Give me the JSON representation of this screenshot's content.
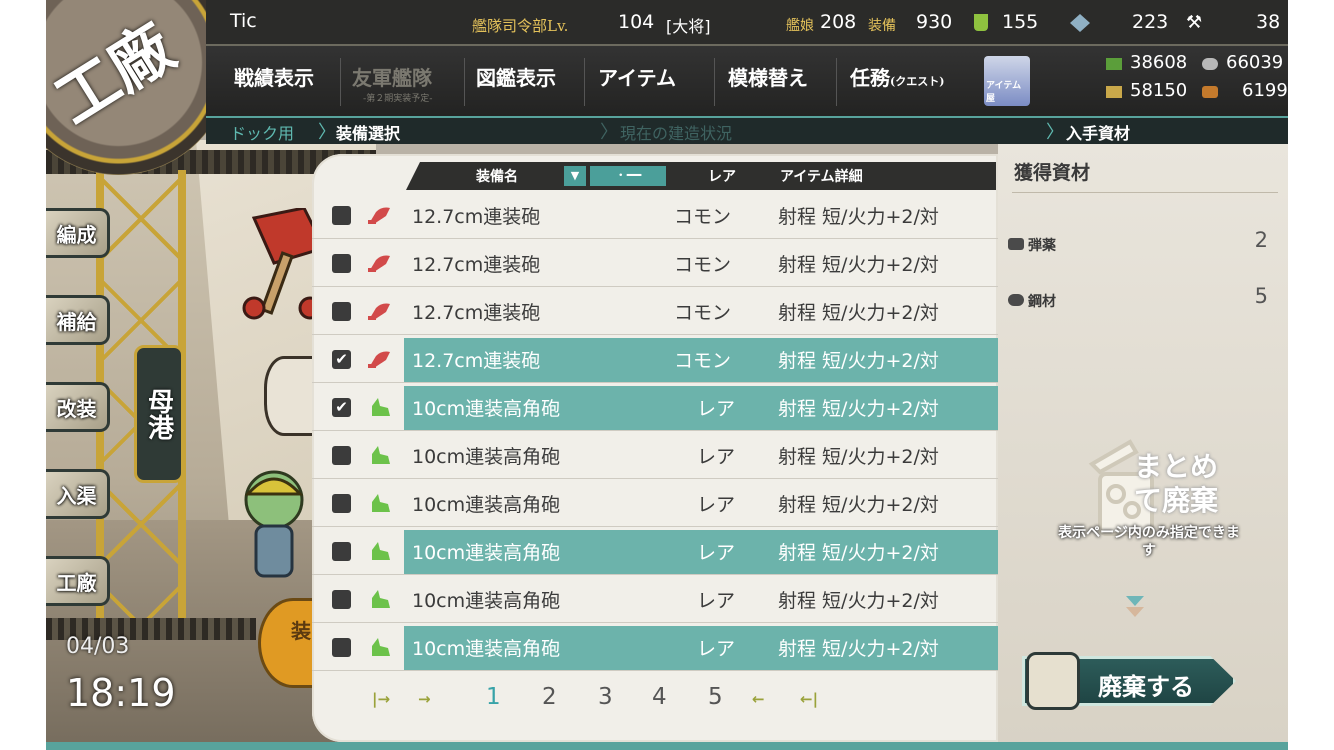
{
  "badge": {
    "title": "工廠"
  },
  "side_nav": [
    "編成",
    "補給",
    "改装",
    "入渠",
    "工廠"
  ],
  "port_label": "母港",
  "clock": {
    "date": "04/03",
    "time": "18:19"
  },
  "topbar": {
    "admiral": "Tic",
    "hq_label": "艦隊司令部Lv.",
    "hq_level": "104",
    "rank": "[大将]",
    "ships_label": "艦娘",
    "ships": "208",
    "equip_label": "装備",
    "equip": "930",
    "bucket": "155",
    "devmat": "223",
    "screws": "38"
  },
  "menu": {
    "record": "戦績表示",
    "friendly": "友軍艦隊",
    "friendly_sub": "-第２期実装予定-",
    "album": "図鑑表示",
    "items": "アイテム",
    "remodel": "模様替え",
    "quest": "任務",
    "quest_sub": "(クエスト)",
    "item_shop": "アイテム屋"
  },
  "resources": {
    "fuel": "38608",
    "steel": "66039",
    "ammo": "58150",
    "bauxite": "6199"
  },
  "breadcrumb": {
    "dock": "ドック用",
    "select": "装備選択",
    "current": "現在の建造状況",
    "gain": "入手資材"
  },
  "list": {
    "header": {
      "name": "装備名",
      "sort_arrow": "▼",
      "sort_mode": "・━━",
      "rarity": "レア",
      "detail": "アイテム詳細"
    },
    "rows": [
      {
        "checked": false,
        "name": "12.7cm連装砲",
        "rarity": "コモン",
        "detail": "射程 短/火力+2/対",
        "highlight": false,
        "icon": "main-gun-red"
      },
      {
        "checked": false,
        "name": "12.7cm連装砲",
        "rarity": "コモン",
        "detail": "射程 短/火力+2/対",
        "highlight": false,
        "icon": "main-gun-red"
      },
      {
        "checked": false,
        "name": "12.7cm連装砲",
        "rarity": "コモン",
        "detail": "射程 短/火力+2/対",
        "highlight": false,
        "icon": "main-gun-red"
      },
      {
        "checked": true,
        "name": "12.7cm連装砲",
        "rarity": "コモン",
        "detail": "射程 短/火力+2/対",
        "highlight": true,
        "icon": "main-gun-red"
      },
      {
        "checked": true,
        "name": "10cm連装高角砲",
        "rarity": "レア",
        "detail": "射程 短/火力+2/対",
        "highlight": true,
        "icon": "aa-gun-green"
      },
      {
        "checked": false,
        "name": "10cm連装高角砲",
        "rarity": "レア",
        "detail": "射程 短/火力+2/対",
        "highlight": false,
        "icon": "aa-gun-green"
      },
      {
        "checked": false,
        "name": "10cm連装高角砲",
        "rarity": "レア",
        "detail": "射程 短/火力+2/対",
        "highlight": false,
        "icon": "aa-gun-green"
      },
      {
        "checked": false,
        "name": "10cm連装高角砲",
        "rarity": "レア",
        "detail": "射程 短/火力+2/対",
        "highlight": true,
        "icon": "aa-gun-green"
      },
      {
        "checked": false,
        "name": "10cm連装高角砲",
        "rarity": "レア",
        "detail": "射程 短/火力+2/対",
        "highlight": false,
        "icon": "aa-gun-green"
      },
      {
        "checked": false,
        "name": "10cm連装高角砲",
        "rarity": "レア",
        "detail": "射程 短/火力+2/対",
        "highlight": true,
        "icon": "aa-gun-green"
      }
    ],
    "pager": {
      "pages": [
        "1",
        "2",
        "3",
        "4",
        "5"
      ],
      "current": "1"
    }
  },
  "gain_panel": {
    "title": "獲得資材",
    "ammo_label": "弾薬",
    "ammo": "2",
    "steel_label": "鋼材",
    "steel": "5",
    "bulk_title": "まとめて廃棄",
    "bulk_note": "表示ページ内のみ指定できます",
    "scrap_button": "廃棄する"
  },
  "colors": {
    "accent": "#6cb3ab",
    "topbar": "#2b2b29",
    "gold": "#e3c15a"
  }
}
